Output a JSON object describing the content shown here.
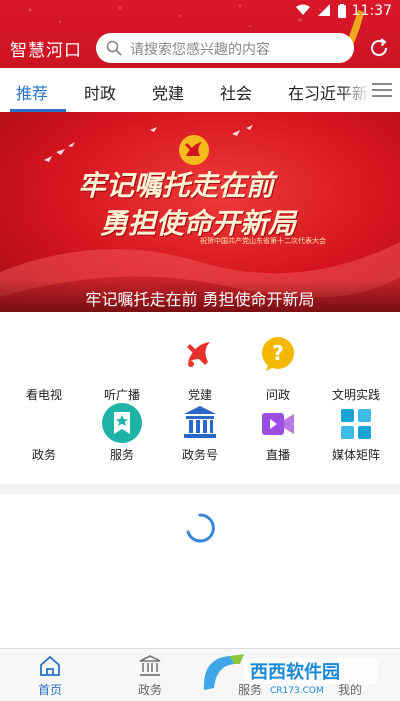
{
  "status_bar": {
    "time": "11:37"
  },
  "header": {
    "app_title": "智慧河口",
    "search_placeholder": "请搜索您感兴趣的内容"
  },
  "tabs": [
    {
      "label": "推荐",
      "active": true
    },
    {
      "label": "时政"
    },
    {
      "label": "党建"
    },
    {
      "label": "社会"
    },
    {
      "label": "在习近平新"
    }
  ],
  "banner": {
    "calligraphy_line1": "牢记嘱托走在前",
    "calligraphy_line2": "勇担使命开新局",
    "small_text": "祝贺中国共产党山东省第十二次代表大会",
    "caption": "牢记嘱托走在前 勇担使命开新局"
  },
  "grid": {
    "row1": [
      {
        "label": "看电视",
        "icon": "tv-icon"
      },
      {
        "label": "听广播",
        "icon": "radio-icon"
      },
      {
        "label": "党建",
        "icon": "party-emblem-icon"
      },
      {
        "label": "问政",
        "icon": "question-icon"
      },
      {
        "label": "文明实践",
        "icon": "civilization-icon"
      }
    ],
    "row2": [
      {
        "label": "政务",
        "icon": "government-affairs-icon"
      },
      {
        "label": "服务",
        "icon": "service-icon"
      },
      {
        "label": "政务号",
        "icon": "government-building-icon"
      },
      {
        "label": "直播",
        "icon": "live-video-icon"
      },
      {
        "label": "媒体矩阵",
        "icon": "media-matrix-icon"
      }
    ]
  },
  "bottom_nav": [
    {
      "label": "首页",
      "icon": "home-icon",
      "active": true
    },
    {
      "label": "政务",
      "icon": "government-icon"
    },
    {
      "label": "服务",
      "icon": "service-nav-icon"
    },
    {
      "label": "我的",
      "icon": "profile-icon"
    }
  ],
  "watermark": {
    "brand": "西西软件园",
    "domain": "CR173.COM"
  },
  "colors": {
    "header_red": "#d9182a",
    "accent_blue": "#2a72c8",
    "gold": "#f5b800"
  }
}
